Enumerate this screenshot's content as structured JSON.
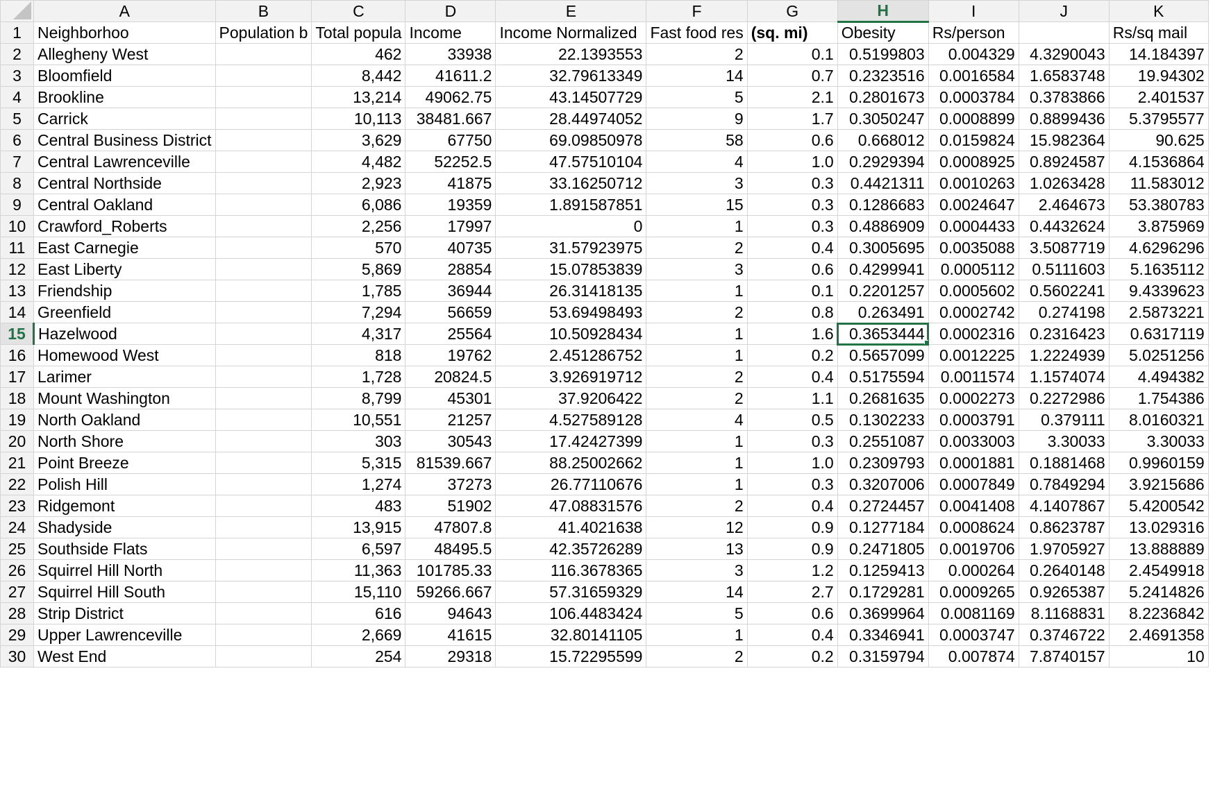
{
  "columns": [
    "A",
    "B",
    "C",
    "D",
    "E",
    "F",
    "G",
    "H",
    "I",
    "J",
    "K"
  ],
  "selected_column": "H",
  "selected_row": 15,
  "header_row": [
    "Neighborhoo",
    "Population b",
    "Total popula",
    "Income",
    "Income Normalized",
    "Fast food res",
    "(sq. mi)",
    "Obesity",
    "Rs/person",
    "",
    "Rs/sq mail"
  ],
  "rows": [
    [
      "Allegheny West",
      "",
      "462",
      "33938",
      "22.1393553",
      "2",
      "0.1",
      "0.5199803",
      "0.004329",
      "4.3290043",
      "14.184397"
    ],
    [
      "Bloomfield",
      "",
      "8,442",
      "41611.2",
      "32.79613349",
      "14",
      "0.7",
      "0.2323516",
      "0.0016584",
      "1.6583748",
      "19.94302"
    ],
    [
      "Brookline",
      "",
      "13,214",
      "49062.75",
      "43.14507729",
      "5",
      "2.1",
      "0.2801673",
      "0.0003784",
      "0.3783866",
      "2.401537"
    ],
    [
      "Carrick",
      "",
      "10,113",
      "38481.667",
      "28.44974052",
      "9",
      "1.7",
      "0.3050247",
      "0.0008899",
      "0.8899436",
      "5.3795577"
    ],
    [
      "Central Business District",
      "",
      "3,629",
      "67750",
      "69.09850978",
      "58",
      "0.6",
      "0.668012",
      "0.0159824",
      "15.982364",
      "90.625"
    ],
    [
      "Central Lawrenceville",
      "",
      "4,482",
      "52252.5",
      "47.57510104",
      "4",
      "1.0",
      "0.2929394",
      "0.0008925",
      "0.8924587",
      "4.1536864"
    ],
    [
      "Central Northside",
      "",
      "2,923",
      "41875",
      "33.16250712",
      "3",
      "0.3",
      "0.4421311",
      "0.0010263",
      "1.0263428",
      "11.583012"
    ],
    [
      "Central Oakland",
      "",
      "6,086",
      "19359",
      "1.891587851",
      "15",
      "0.3",
      "0.1286683",
      "0.0024647",
      "2.464673",
      "53.380783"
    ],
    [
      "Crawford_Roberts",
      "",
      "2,256",
      "17997",
      "0",
      "1",
      "0.3",
      "0.4886909",
      "0.0004433",
      "0.4432624",
      "3.875969"
    ],
    [
      "East Carnegie",
      "",
      "570",
      "40735",
      "31.57923975",
      "2",
      "0.4",
      "0.3005695",
      "0.0035088",
      "3.5087719",
      "4.6296296"
    ],
    [
      "East Liberty",
      "",
      "5,869",
      "28854",
      "15.07853839",
      "3",
      "0.6",
      "0.4299941",
      "0.0005112",
      "0.5111603",
      "5.1635112"
    ],
    [
      "Friendship",
      "",
      "1,785",
      "36944",
      "26.31418135",
      "1",
      "0.1",
      "0.2201257",
      "0.0005602",
      "0.5602241",
      "9.4339623"
    ],
    [
      "Greenfield",
      "",
      "7,294",
      "56659",
      "53.69498493",
      "2",
      "0.8",
      "0.263491",
      "0.0002742",
      "0.274198",
      "2.5873221"
    ],
    [
      "Hazelwood",
      "",
      "4,317",
      "25564",
      "10.50928434",
      "1",
      "1.6",
      "0.3653444",
      "0.0002316",
      "0.2316423",
      "0.6317119"
    ],
    [
      "Homewood West",
      "",
      "818",
      "19762",
      "2.451286752",
      "1",
      "0.2",
      "0.5657099",
      "0.0012225",
      "1.2224939",
      "5.0251256"
    ],
    [
      "Larimer",
      "",
      "1,728",
      "20824.5",
      "3.926919712",
      "2",
      "0.4",
      "0.5175594",
      "0.0011574",
      "1.1574074",
      "4.494382"
    ],
    [
      "Mount Washington",
      "",
      "8,799",
      "45301",
      "37.9206422",
      "2",
      "1.1",
      "0.2681635",
      "0.0002273",
      "0.2272986",
      "1.754386"
    ],
    [
      "North Oakland",
      "",
      "10,551",
      "21257",
      "4.527589128",
      "4",
      "0.5",
      "0.1302233",
      "0.0003791",
      "0.379111",
      "8.0160321"
    ],
    [
      "North Shore",
      "",
      "303",
      "30543",
      "17.42427399",
      "1",
      "0.3",
      "0.2551087",
      "0.0033003",
      "3.30033",
      "3.30033"
    ],
    [
      "Point Breeze",
      "",
      "5,315",
      "81539.667",
      "88.25002662",
      "1",
      "1.0",
      "0.2309793",
      "0.0001881",
      "0.1881468",
      "0.9960159"
    ],
    [
      "Polish Hill",
      "",
      "1,274",
      "37273",
      "26.77110676",
      "1",
      "0.3",
      "0.3207006",
      "0.0007849",
      "0.7849294",
      "3.9215686"
    ],
    [
      "Ridgemont",
      "",
      "483",
      "51902",
      "47.08831576",
      "2",
      "0.4",
      "0.2724457",
      "0.0041408",
      "4.1407867",
      "5.4200542"
    ],
    [
      "Shadyside",
      "",
      "13,915",
      "47807.8",
      "41.4021638",
      "12",
      "0.9",
      "0.1277184",
      "0.0008624",
      "0.8623787",
      "13.029316"
    ],
    [
      "Southside Flats",
      "",
      "6,597",
      "48495.5",
      "42.35726289",
      "13",
      "0.9",
      "0.2471805",
      "0.0019706",
      "1.9705927",
      "13.888889"
    ],
    [
      "Squirrel Hill North",
      "",
      "11,363",
      "101785.33",
      "116.3678365",
      "3",
      "1.2",
      "0.1259413",
      "0.000264",
      "0.2640148",
      "2.4549918"
    ],
    [
      "Squirrel Hill South",
      "",
      "15,110",
      "59266.667",
      "57.31659329",
      "14",
      "2.7",
      "0.1729281",
      "0.0009265",
      "0.9265387",
      "5.2414826"
    ],
    [
      "Strip District",
      "",
      "616",
      "94643",
      "106.4483424",
      "5",
      "0.6",
      "0.3699964",
      "0.0081169",
      "8.1168831",
      "8.2236842"
    ],
    [
      "Upper Lawrenceville",
      "",
      "2,669",
      "41615",
      "32.80141105",
      "1",
      "0.4",
      "0.3346941",
      "0.0003747",
      "0.3746722",
      "2.4691358"
    ],
    [
      "West End",
      "",
      "254",
      "29318",
      "15.72295599",
      "2",
      "0.2",
      "0.3159794",
      "0.007874",
      "7.8740157",
      "10"
    ]
  ]
}
